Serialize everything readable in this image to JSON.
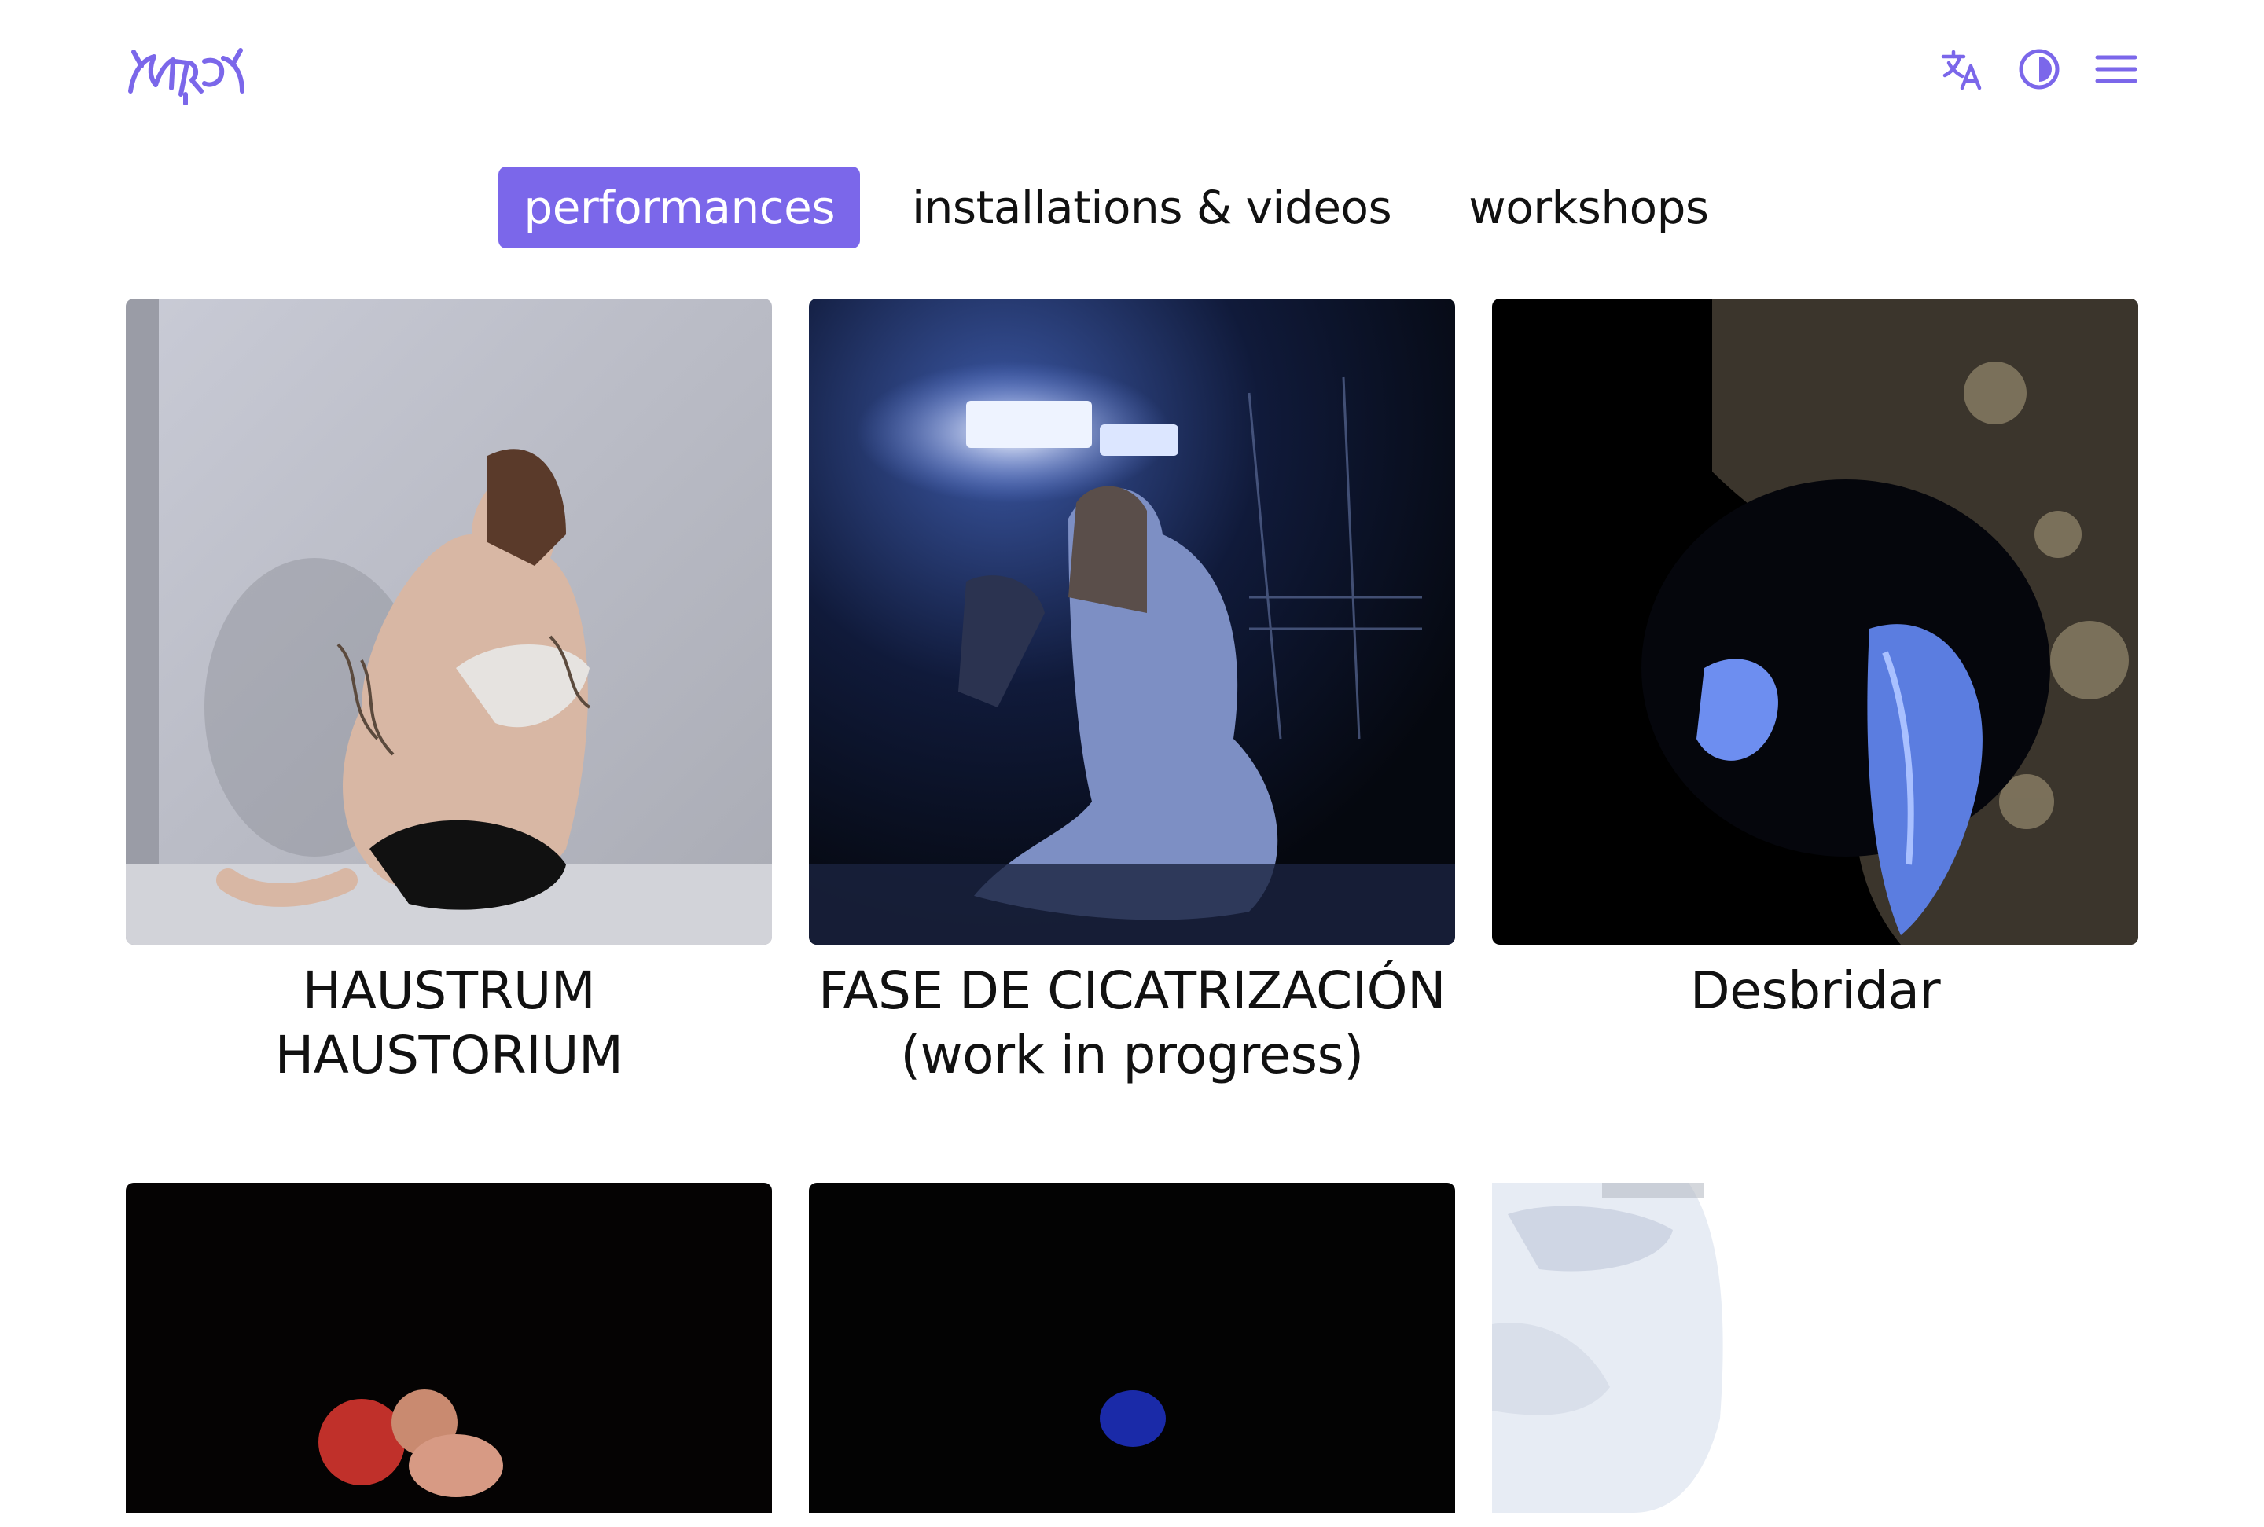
{
  "header": {
    "logo_icon": "creature-wordmark-logo",
    "icons": [
      "translate-icon",
      "contrast-icon",
      "menu-icon"
    ],
    "accent_color": "#7b67ea"
  },
  "tabs": [
    {
      "label": "performances",
      "active": true
    },
    {
      "label": "installations & videos",
      "active": false
    },
    {
      "label": "workshops",
      "active": false
    }
  ],
  "works": [
    {
      "title": "HAUSTRUM HAUSTORIUM"
    },
    {
      "title": "FASE DE CICATRIZACIÓN (work in progress)"
    },
    {
      "title": "Desbridar"
    },
    {
      "title": ""
    },
    {
      "title": ""
    },
    {
      "title": ""
    }
  ]
}
